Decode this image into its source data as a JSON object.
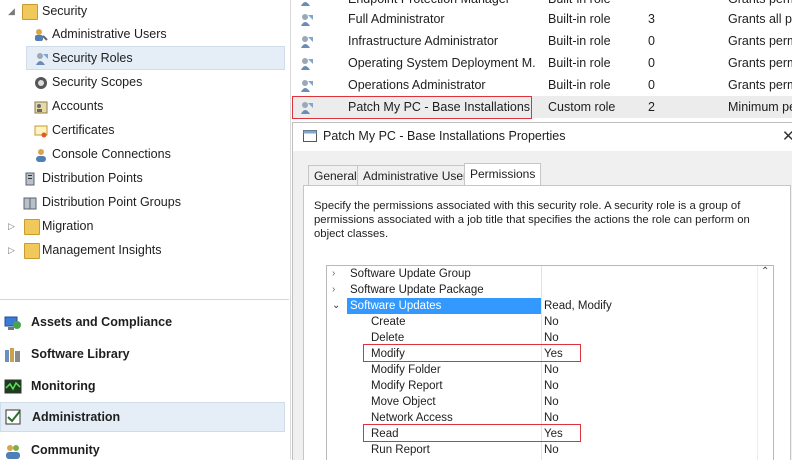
{
  "nav": {
    "tree": [
      {
        "label": "Security"
      },
      {
        "label": "Administrative Users"
      },
      {
        "label": "Security Roles"
      },
      {
        "label": "Security Scopes"
      },
      {
        "label": "Accounts"
      },
      {
        "label": "Certificates"
      },
      {
        "label": "Console Connections"
      },
      {
        "label": "Distribution Points"
      },
      {
        "label": "Distribution Point Groups"
      },
      {
        "label": "Migration"
      },
      {
        "label": "Management Insights"
      }
    ],
    "workspaces": [
      {
        "label": "Assets and Compliance"
      },
      {
        "label": "Software Library"
      },
      {
        "label": "Monitoring"
      },
      {
        "label": "Administration"
      },
      {
        "label": "Community"
      }
    ]
  },
  "list": {
    "rows": [
      {
        "name": "Endpoint Protection Manager",
        "type": "Built-in role",
        "count": "",
        "desc": "Grants perm"
      },
      {
        "name": "Full Administrator",
        "type": "Built-in role",
        "count": "3",
        "desc": "Grants all pe"
      },
      {
        "name": "Infrastructure Administrator",
        "type": "Built-in role",
        "count": "0",
        "desc": "Grants perm"
      },
      {
        "name": "Operating System Deployment M...",
        "type": "Built-in role",
        "count": "0",
        "desc": "Grants perm"
      },
      {
        "name": "Operations Administrator",
        "type": "Built-in role",
        "count": "0",
        "desc": "Grants perm"
      },
      {
        "name": "Patch My PC - Base Installations",
        "type": "Custom role",
        "count": "2",
        "desc": "Minimum pe"
      }
    ]
  },
  "dialog": {
    "title": "Patch My PC - Base Installations Properties",
    "close": "✕",
    "tabs": [
      {
        "label": "General"
      },
      {
        "label": "Administrative Users"
      },
      {
        "label": "Permissions"
      }
    ],
    "description": "Specify the permissions associated with this security role. A security role is a group of permissions associated with a job title that specifies the actions the role can perform on object classes.",
    "permissions": [
      {
        "name": "Software Update Group",
        "value": "",
        "expander": "›"
      },
      {
        "name": "Software Update Package",
        "value": "",
        "expander": "›"
      },
      {
        "name": "Software Updates",
        "value": "Read, Modify",
        "expander": "⌄"
      },
      {
        "name": "Create",
        "value": "No",
        "expander": ""
      },
      {
        "name": "Delete",
        "value": "No",
        "expander": ""
      },
      {
        "name": "Modify",
        "value": "Yes",
        "expander": ""
      },
      {
        "name": "Modify Folder",
        "value": "No",
        "expander": ""
      },
      {
        "name": "Modify Report",
        "value": "No",
        "expander": ""
      },
      {
        "name": "Move Object",
        "value": "No",
        "expander": ""
      },
      {
        "name": "Network Access",
        "value": "No",
        "expander": ""
      },
      {
        "name": "Read",
        "value": "Yes",
        "expander": ""
      },
      {
        "name": "Run Report",
        "value": "No",
        "expander": ""
      }
    ],
    "scroll_up": "⌃"
  },
  "colors": {
    "selection": "#3399ff",
    "highlight_box": "#e0323a",
    "nav_selected": "#e5eef7"
  }
}
